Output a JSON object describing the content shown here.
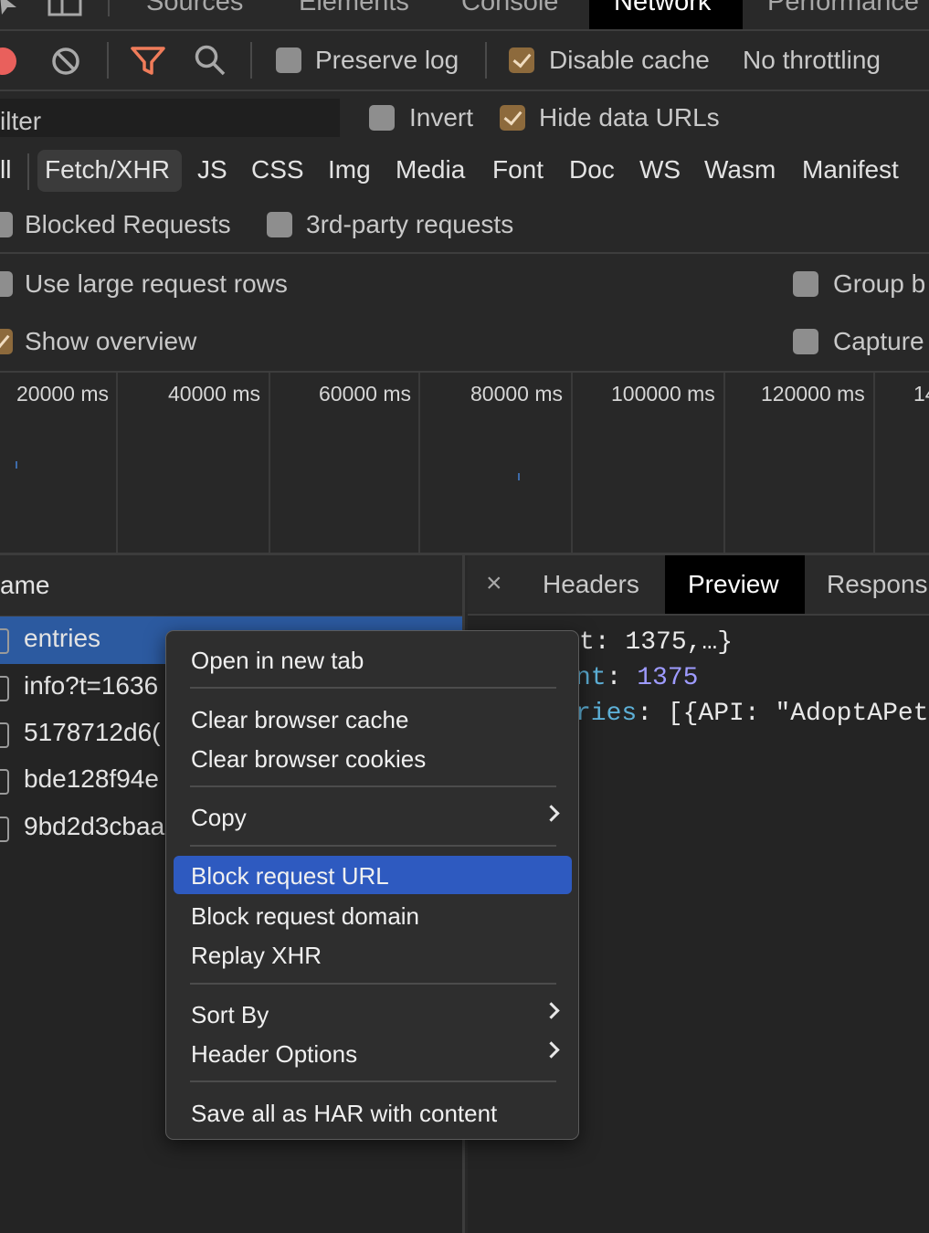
{
  "tabs": {
    "sources": "Sources",
    "elements": "Elements",
    "console": "Console",
    "network": "Network",
    "performance": "Performance"
  },
  "toolbar": {
    "preserve_log": "Preserve log",
    "disable_cache": "Disable cache",
    "throttling": "No throttling"
  },
  "filter": {
    "placeholder": "ilter",
    "invert": "Invert",
    "hide_data_urls": "Hide data URLs",
    "types": [
      "ll",
      "Fetch/XHR",
      "JS",
      "CSS",
      "Img",
      "Media",
      "Font",
      "Doc",
      "WS",
      "Wasm",
      "Manifest"
    ],
    "blocked_requests": "Blocked Requests",
    "third_party": "3rd-party requests"
  },
  "settings": {
    "large_rows": "Use large request rows",
    "group_by": "Group b",
    "show_overview": "Show overview",
    "capture": "Capture"
  },
  "overview": {
    "ticks": [
      "20000 ms",
      "40000 ms",
      "60000 ms",
      "80000 ms",
      "100000 ms",
      "120000 ms",
      "14"
    ]
  },
  "requests": {
    "header": "ame",
    "rows": [
      "entries",
      "info?t=1636",
      "5178712d6(",
      "bde128f94e",
      "9bd2d3cbaa"
    ]
  },
  "detail": {
    "tabs": {
      "close": "×",
      "headers": "Headers",
      "preview": "Preview",
      "response": "Respons"
    },
    "preview": {
      "line1": "t: 1375,…}",
      "line2_key": "nt",
      "line2_value": "1375",
      "line3_key": "ries",
      "line3_value": "[{API: \"AdoptAPet\""
    }
  },
  "context_menu": {
    "open_new_tab": "Open in new tab",
    "clear_cache": "Clear browser cache",
    "clear_cookies": "Clear browser cookies",
    "copy": "Copy",
    "block_url": "Block request URL",
    "block_domain": "Block request domain",
    "replay_xhr": "Replay XHR",
    "sort_by": "Sort By",
    "header_options": "Header Options",
    "save_har": "Save all as HAR with content"
  },
  "colors": {
    "highlight": "#2e5ac0",
    "selected_row": "#2c5aa0",
    "checkbox_checked": "#8d6a3c",
    "record_red": "#e9605c",
    "filter_orange": "#f07c5a",
    "json_number": "#9e9bff",
    "json_key": "#5db0d7"
  }
}
